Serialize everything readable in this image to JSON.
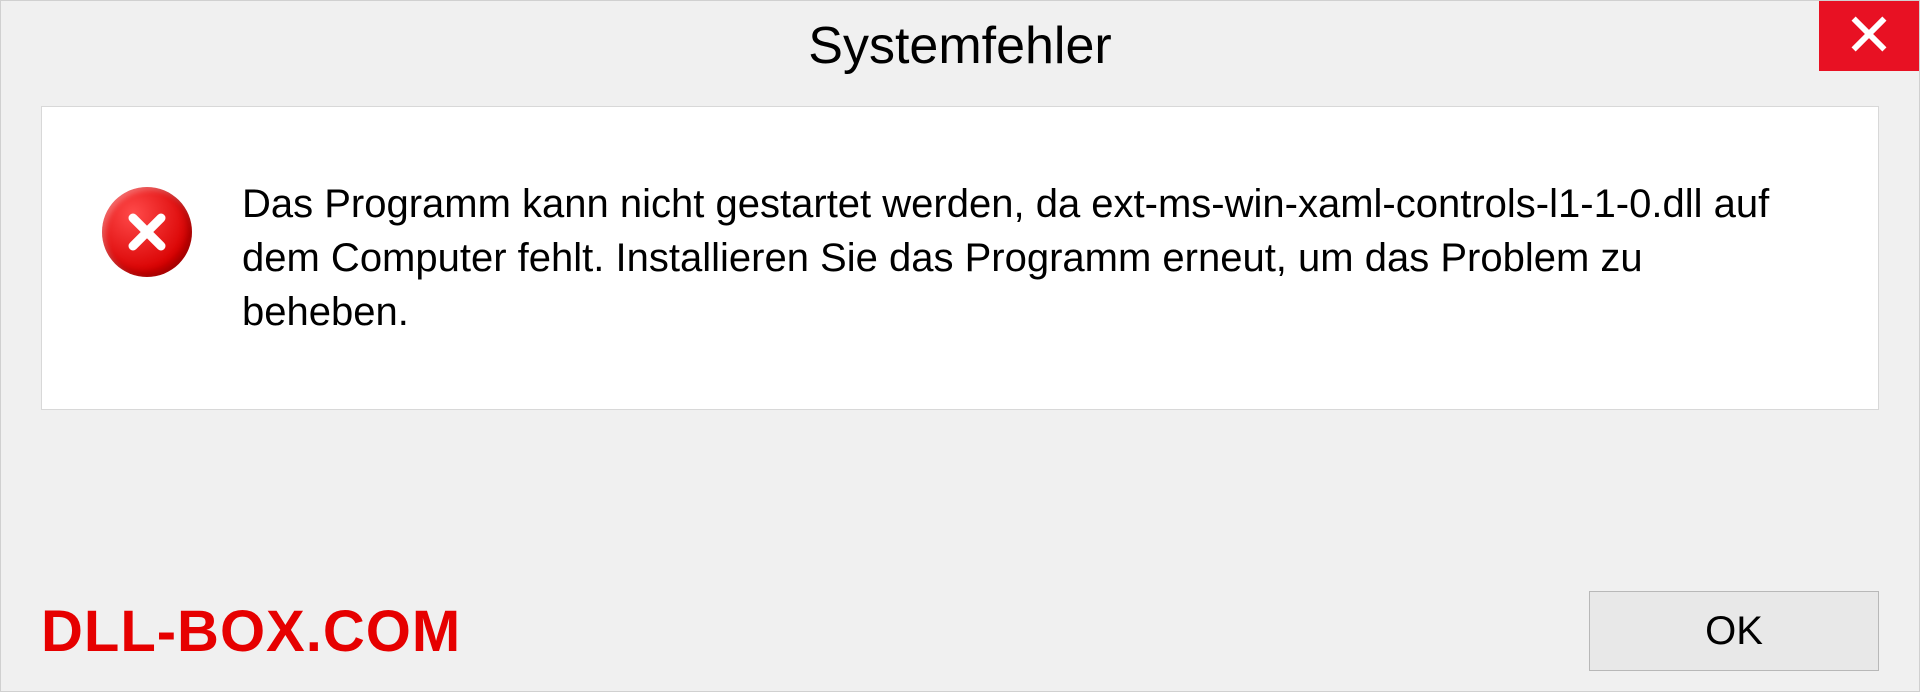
{
  "dialog": {
    "title": "Systemfehler",
    "message": "Das Programm kann nicht gestartet werden, da ext-ms-win-xaml-controls-l1-1-0.dll auf dem Computer fehlt. Installieren Sie das Programm erneut, um das Problem zu beheben.",
    "ok_label": "OK"
  },
  "watermark": "DLL-BOX.COM",
  "colors": {
    "close_button": "#e81123",
    "error_icon": "#d80000",
    "watermark": "#e60000"
  }
}
